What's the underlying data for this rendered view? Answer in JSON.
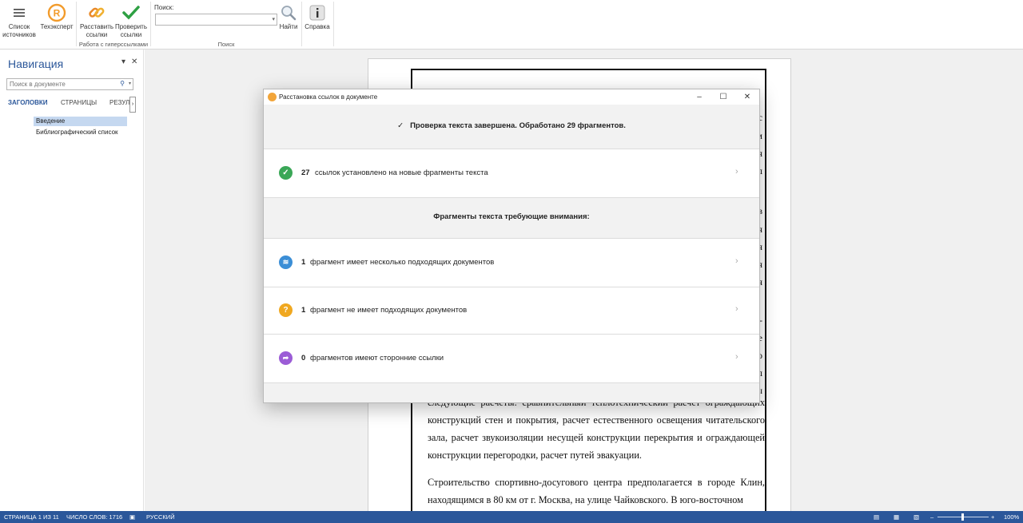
{
  "ribbon": {
    "sources_label_1": "Список",
    "sources_label_2": "источников",
    "tech_label": "Техэксперт",
    "place_links_1": "Расставить",
    "place_links_2": "ссылки",
    "check_links_1": "Проверить",
    "check_links_2": "ссылки",
    "links_group": "Работа с гиперссылками",
    "search_label": "Поиск:",
    "search_value": "",
    "find_label": "Найти",
    "search_group": "Поиск",
    "help_label": "Справка"
  },
  "nav": {
    "title": "Навигация",
    "search_placeholder": "Поиск в документе",
    "tabs": [
      "ЗАГОЛОВКИ",
      "СТРАНИЦЫ",
      "РЕЗУЛЬ"
    ],
    "headings": [
      "Введение",
      "Библиографический список"
    ]
  },
  "document": {
    "right_glyphs": [
      "с",
      "м",
      "я",
      "л",
      "в",
      "я",
      "я",
      "я",
      "я",
      "-",
      "е",
      "о",
      "л",
      "ы"
    ],
    "paragraph1": "следующие расчеты: сравнительный теплотехнический расчет ограждающих конструкций стен и покрытия, расчет естественного освещения читательского зала, расчет звукоизоляции несущей конструкции перекрытия и ограждающей конструкции перегородки, расчет путей эвакуации.",
    "paragraph2": "Строительство спортивно-досугового центра предполагается в городе Клин, находящимся в 80 км от г. Москва, на улице Чайковского. В юго-восточном"
  },
  "dialog": {
    "title": "Расстановка ссылок в документе",
    "check_done": "Проверка текста завершена. Обработано 29 фрагментов.",
    "rows": [
      {
        "count": "27",
        "text": "ссылок установлено на новые фрагменты текста",
        "color": "#3aa757",
        "icon": "check-circle-icon"
      },
      {
        "count": "1",
        "text": "фрагмент имеет несколько подходящих документов",
        "color": "#3b8ed6",
        "icon": "layers-icon"
      },
      {
        "count": "1",
        "text": "фрагмент не имеет подходящих документов",
        "color": "#f0a820",
        "icon": "question-icon"
      },
      {
        "count": "0",
        "text": "фрагментов имеют сторонние ссылки",
        "color": "#9b5cd6",
        "icon": "share-arrow-icon"
      }
    ],
    "attention_header": "Фрагменты текста требующие внимания:"
  },
  "status": {
    "page": "СТРАНИЦА 1 ИЗ 11",
    "words": "ЧИСЛО СЛОВ: 1716",
    "language": "РУССКИЙ",
    "zoom": "100%"
  }
}
